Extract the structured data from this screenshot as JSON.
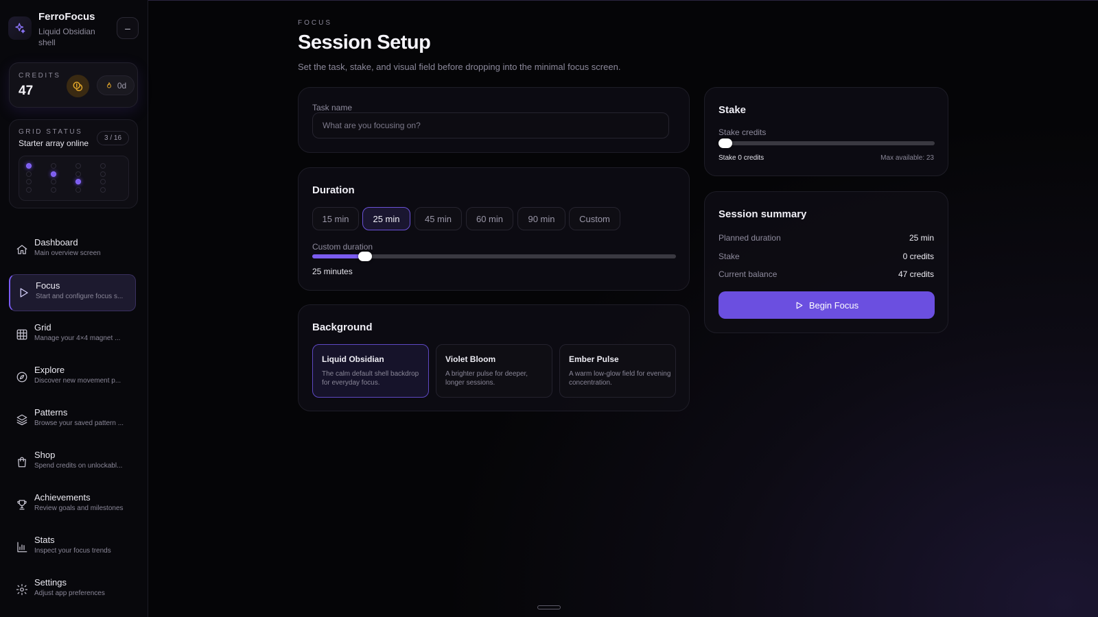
{
  "app": {
    "name": "FerroFocus",
    "subtitle": "Liquid Obsidian shell",
    "collapse_label": "–"
  },
  "credits": {
    "label": "CREDITS",
    "value": "47",
    "streak": "0d"
  },
  "grid_status": {
    "label": "GRID STATUS",
    "title": "Starter array online",
    "count": "3 / 16",
    "magnets_on": [
      0,
      5,
      10
    ]
  },
  "nav": [
    {
      "title": "Dashboard",
      "sub": "Main overview screen",
      "icon": "home-icon"
    },
    {
      "title": "Focus",
      "sub": "Start and configure focus s...",
      "icon": "play-icon",
      "active": true
    },
    {
      "title": "Grid",
      "sub": "Manage your 4×4 magnet ...",
      "icon": "grid-icon"
    },
    {
      "title": "Explore",
      "sub": "Discover new movement p...",
      "icon": "compass-icon"
    },
    {
      "title": "Patterns",
      "sub": "Browse your saved pattern ...",
      "icon": "layers-icon"
    },
    {
      "title": "Shop",
      "sub": "Spend credits on unlockabl...",
      "icon": "shopping-bag-icon"
    },
    {
      "title": "Achievements",
      "sub": "Review goals and milestones",
      "icon": "trophy-icon"
    },
    {
      "title": "Stats",
      "sub": "Inspect your focus trends",
      "icon": "bar-chart-icon"
    },
    {
      "title": "Settings",
      "sub": "Adjust app preferences",
      "icon": "gear-icon"
    }
  ],
  "header": {
    "eyebrow": "FOCUS",
    "title": "Session Setup",
    "subtitle": "Set the task, stake, and visual field before dropping into the minimal focus screen."
  },
  "task": {
    "label": "Task name",
    "placeholder": "What are you focusing on?",
    "value": ""
  },
  "duration": {
    "title": "Duration",
    "options": [
      "15 min",
      "25 min",
      "45 min",
      "60 min",
      "90 min",
      "Custom"
    ],
    "selected_index": 1,
    "custom_label": "Custom duration",
    "slider_fraction": 0.127,
    "value_text": "25 minutes"
  },
  "background": {
    "title": "Background",
    "options": [
      {
        "name": "Liquid Obsidian",
        "desc": "The calm default shell backdrop for everyday focus.",
        "active": true
      },
      {
        "name": "Violet Bloom",
        "desc": "A brighter pulse for deeper, longer sessions."
      },
      {
        "name": "Ember Pulse",
        "desc": "A warm low-glow field for evening concentration."
      }
    ]
  },
  "stake": {
    "title": "Stake",
    "label": "Stake credits",
    "slider_fraction": 0,
    "value_text": "Stake 0 credits",
    "max_text": "Max available: 23"
  },
  "summary": {
    "title": "Session summary",
    "rows": [
      {
        "label": "Planned duration",
        "value": "25 min"
      },
      {
        "label": "Stake",
        "value": "0 credits"
      },
      {
        "label": "Current balance",
        "value": "47 credits"
      }
    ],
    "button_label": "Begin Focus"
  },
  "colors": {
    "accent": "#6b4fe0",
    "accent_light": "#7b5cf0",
    "coin": "#e0a52a",
    "background": "#050507"
  }
}
